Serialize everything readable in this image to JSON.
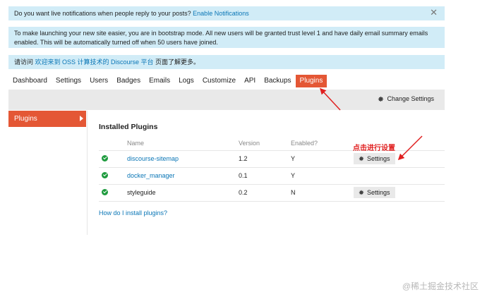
{
  "banners": {
    "notify_text": "Do you want live notifications when people reply to your posts?",
    "notify_link": "Enable Notifications",
    "close_glyph": "✕",
    "bootstrap_text": "To make launching your new site easier, you are in bootstrap mode. All new users will be granted trust level 1 and have daily email summary emails enabled. This will be automatically turned off when 50 users have joined.",
    "welcome_prefix": "请访问 ",
    "welcome_link": "欢迎来到 OSS 计算技术的 Discourse 平台",
    "welcome_suffix": " 页面了解更多。"
  },
  "nav": {
    "tabs": [
      {
        "label": "Dashboard"
      },
      {
        "label": "Settings"
      },
      {
        "label": "Users"
      },
      {
        "label": "Badges"
      },
      {
        "label": "Emails"
      },
      {
        "label": "Logs"
      },
      {
        "label": "Customize"
      },
      {
        "label": "API"
      },
      {
        "label": "Backups"
      },
      {
        "label": "Plugins"
      }
    ],
    "active_tab": "Plugins"
  },
  "toolbar": {
    "change_settings_label": "Change Settings"
  },
  "sidebar": {
    "items": [
      {
        "label": "Plugins"
      }
    ]
  },
  "panel": {
    "title": "Installed Plugins",
    "columns": [
      "Name",
      "Version",
      "Enabled?"
    ],
    "plugins": [
      {
        "name": "discourse-sitemap",
        "version": "1.2",
        "enabled": "Y",
        "linked": true,
        "settings_label": "Settings"
      },
      {
        "name": "docker_manager",
        "version": "0.1",
        "enabled": "Y",
        "linked": true,
        "settings_label": ""
      },
      {
        "name": "styleguide",
        "version": "0.2",
        "enabled": "N",
        "linked": false,
        "settings_label": "Settings"
      }
    ],
    "howto_link": "How do I install plugins?"
  },
  "annotation": {
    "text": "点击进行设置"
  },
  "watermark": "@稀土掘金技术社区",
  "colors": {
    "accent": "#e45735",
    "banner_bg": "#d1ecf7",
    "link": "#0a76b6",
    "success": "#1e9b3e",
    "annotation": "#e02020"
  }
}
